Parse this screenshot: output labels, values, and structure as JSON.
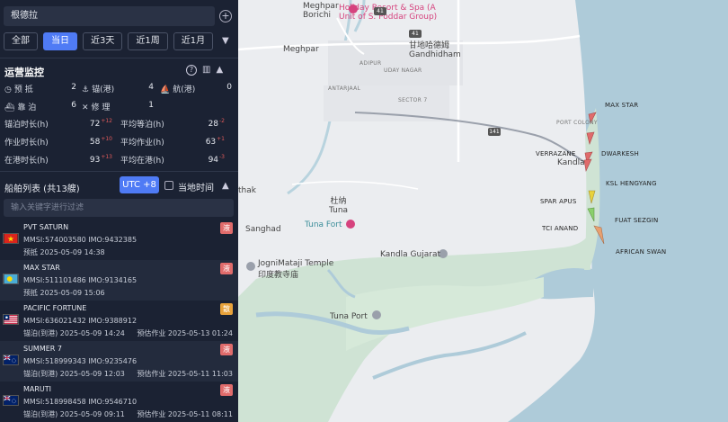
{
  "search": {
    "value": "根德拉"
  },
  "filters": [
    "全部",
    "当日",
    "近3天",
    "近1周",
    "近1月"
  ],
  "filter_active": 1,
  "ops": {
    "title": "运营监控",
    "counts": [
      {
        "icon": "clock",
        "label": "预 抵",
        "value": "2"
      },
      {
        "icon": "anchor",
        "label": "锚(港)",
        "value": "4"
      },
      {
        "icon": "sail",
        "label": "航(港)",
        "value": "0"
      },
      {
        "icon": "berth",
        "label": "靠 泊",
        "value": "6"
      },
      {
        "icon": "wrench",
        "label": "修 理",
        "value": "1"
      }
    ],
    "metrics": [
      {
        "label": "锚泊时长(h)",
        "value": "72",
        "delta": "+12"
      },
      {
        "label": "平均等泊(h)",
        "value": "28",
        "delta": "-2"
      },
      {
        "label": "作业时长(h)",
        "value": "58",
        "delta": "+10"
      },
      {
        "label": "平均作业(h)",
        "value": "63",
        "delta": "+1"
      },
      {
        "label": "在港时长(h)",
        "value": "93",
        "delta": "+13"
      },
      {
        "label": "平均在港(h)",
        "value": "94",
        "delta": "-3"
      }
    ]
  },
  "ships_header": {
    "title": "船舶列表 (共13艘)",
    "utc": "UTC +8",
    "local_time": "当地时间"
  },
  "ships_filter_placeholder": "输入关键字进行过滤",
  "ships": [
    {
      "name": "PVT SATURN",
      "id": "MMSI:574003580  IMO:9432385",
      "status": "预抵 2025-05-09 14:38",
      "est": "",
      "badge": "液",
      "badge_color": "#e06b6b",
      "flag": "vietnam"
    },
    {
      "name": "MAX STAR",
      "id": "MMSI:511101486  IMO:9134165",
      "status": "预抵 2025-05-09 15:06",
      "est": "",
      "badge": "液",
      "badge_color": "#e06b6b",
      "flag": "palau"
    },
    {
      "name": "PACIFIC FORTUNE",
      "id": "MMSI:636021432  IMO:9388912",
      "status": "锚泊(到港) 2025-05-09 14:24",
      "est": "预估作业 2025-05-13 01:24",
      "badge": "散",
      "badge_color": "#e8a23b",
      "flag": "liberia"
    },
    {
      "name": "SUMMER 7",
      "id": "MMSI:518999343  IMO:9235476",
      "status": "锚泊(到港) 2025-05-09 12:03",
      "est": "预估作业 2025-05-11 11:03",
      "badge": "液",
      "badge_color": "#e06b6b",
      "flag": "cook"
    },
    {
      "name": "MARUTI",
      "id": "MMSI:518998458  IMO:9546710",
      "status": "锚泊(到港) 2025-05-09 09:11",
      "est": "预估作业 2025-05-11 08:11",
      "badge": "液",
      "badge_color": "#e06b6b",
      "flag": "cook"
    }
  ],
  "map": {
    "places": {
      "meghpar_borichi": "Meghpar\nBorichi",
      "holiday_resort": "Holiday Resort & Spa (A\nUnit of S. Poddar Group)",
      "meghpar": "Meghpar",
      "gandhidham": "甘地哈德姆\nGandhidham",
      "adipur": "ADIPUR",
      "uday_nagar": "UDAY NAGAR",
      "antarjaal": "ANTARJAAL",
      "sector7": "SECTOR 7",
      "port_colony": "PORT COLONY",
      "verrazane": "VERRAZANE",
      "kandla": "Kandla",
      "thak": "thak",
      "tuna": "杜纳\nTuna",
      "tuna_fort": "Tuna Fort",
      "sanghad": "Sanghad",
      "jognimataji": "JogniMataji Temple\n印度教寺庙",
      "kandla_gujarat": "Kandla Gujarat",
      "tuna_port": "Tuna Port"
    },
    "roads": [
      "41",
      "41",
      "141"
    ],
    "vessels": [
      {
        "name": "MAX STAR",
        "color": "#e06b6b"
      },
      {
        "name": "DWARKESH",
        "color": "#e06b6b"
      },
      {
        "name": "KSL HENGYANG",
        "color": "#e06b6b"
      },
      {
        "name": "SPAR APUS",
        "color": "#e8d23b"
      },
      {
        "name": "FUAT SEZGIN",
        "color": "#8ad06b"
      },
      {
        "name": "TCI ANAND",
        "color": "#8ad06b"
      },
      {
        "name": "AFRICAN SWAN",
        "color": "#e8a070"
      }
    ]
  }
}
